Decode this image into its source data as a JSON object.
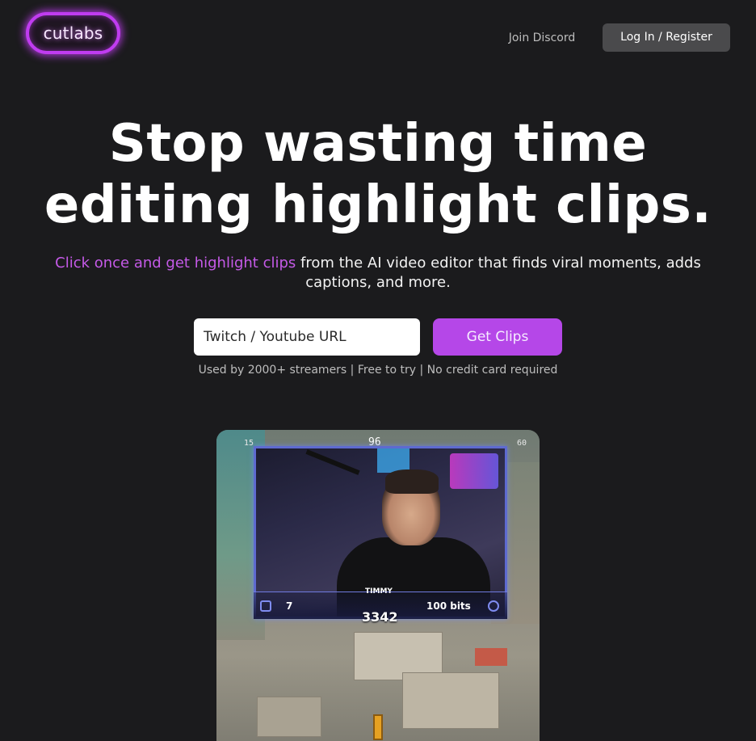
{
  "header": {
    "logo_text": "cutlabs",
    "nav_link": "Join Discord",
    "login_label": "Log In / Register"
  },
  "hero": {
    "headline_line1": "Stop wasting time",
    "headline_line2": "editing highlight clips.",
    "sub_accent": "Click once and get highlight clips",
    "sub_rest": " from the AI video editor that finds viral moments, adds captions, and more.",
    "url_placeholder": "Twitch / Youtube URL",
    "cta_label": "Get Clips",
    "usage_note": "Used by 2000+ streamers | Free to try | No credit card required"
  },
  "video": {
    "compass_left": "15",
    "compass_center": "96",
    "compass_right": "60",
    "streamer_name": "TIMMY",
    "hud_left_value": "7",
    "hud_right_value": "100 bits",
    "score": "3342"
  },
  "colors": {
    "background": "#1b1b1d",
    "accent_purple": "#b547e8",
    "accent_text": "#c55ae8",
    "login_bg": "#4a4a4c"
  }
}
